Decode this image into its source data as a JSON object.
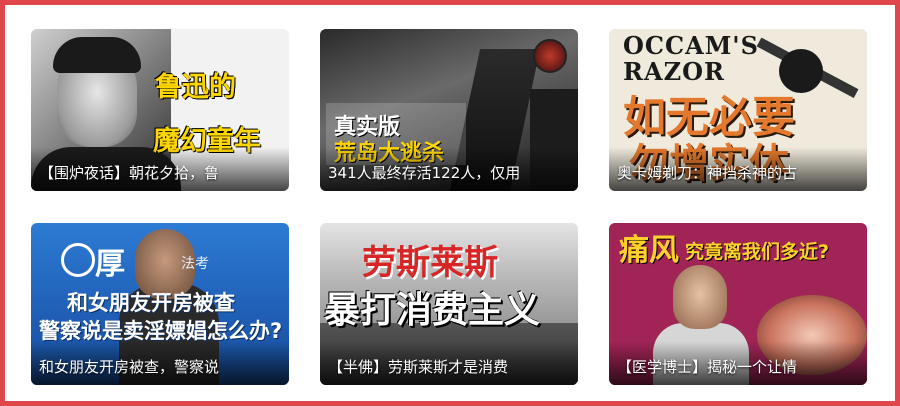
{
  "cards": [
    {
      "overlay_line1": "鲁迅的",
      "overlay_line2": "魔幻童年",
      "caption": "【围炉夜话】朝花夕拾，鲁"
    },
    {
      "overlay_line1": "真实版",
      "overlay_line2": "荒岛大逃杀",
      "caption": "341人最终存活122人，仅用"
    },
    {
      "overlay_top1": "OCCAM'S",
      "overlay_top2": "RAZOR",
      "overlay_line1": "如无必要",
      "overlay_line2": "勿增实体",
      "caption": "奥卡姆剃刀：神挡杀神的古"
    },
    {
      "overlay_top1": "厚",
      "overlay_top2": "法考",
      "overlay_line1": "和女朋友开房被查",
      "overlay_line2": "警察说是卖淫嫖娼怎么办?",
      "caption": "和女朋友开房被查，警察说"
    },
    {
      "overlay_line1": "劳斯莱斯",
      "overlay_line2": "暴打消费主义",
      "caption": "【半佛】劳斯莱斯才是消费"
    },
    {
      "overlay_line1": "痛风",
      "overlay_line2": "究竟离我们多近?",
      "caption": "【医学博士】揭秘一个让情"
    }
  ],
  "colors": {
    "frame_border": "#e0474c",
    "caption_text": "#ffffff"
  }
}
